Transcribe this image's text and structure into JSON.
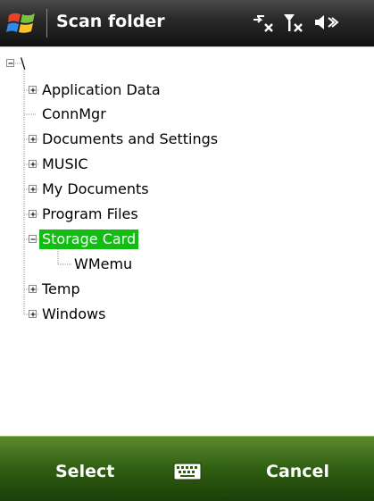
{
  "window": {
    "title": "Scan folder",
    "title_icon": "windows-flag-icon",
    "status_icons": [
      "connectivity-off-icon",
      "signal-off-icon",
      "speaker-mute-icon"
    ]
  },
  "tree": {
    "root": {
      "label": "\\",
      "state": "expanded",
      "expander": "minus"
    },
    "items": [
      {
        "label": "Application Data",
        "expander": "plus",
        "selected": false
      },
      {
        "label": "ConnMgr",
        "expander": "none",
        "selected": false
      },
      {
        "label": "Documents and Settings",
        "expander": "plus",
        "selected": false
      },
      {
        "label": "MUSIC",
        "expander": "plus",
        "selected": false
      },
      {
        "label": "My Documents",
        "expander": "plus",
        "selected": false
      },
      {
        "label": "Program Files",
        "expander": "plus",
        "selected": false
      },
      {
        "label": "Storage Card",
        "expander": "minus",
        "selected": true,
        "children": [
          {
            "label": "WMemu",
            "expander": "none"
          }
        ]
      },
      {
        "label": "Temp",
        "expander": "plus",
        "selected": false
      },
      {
        "label": "Windows",
        "expander": "plus",
        "selected": false
      }
    ],
    "selection_color": "#10bd10"
  },
  "menubar": {
    "left_label": "Select",
    "right_label": "Cancel",
    "center_icon": "keyboard-icon",
    "color": "#2f5e12"
  }
}
